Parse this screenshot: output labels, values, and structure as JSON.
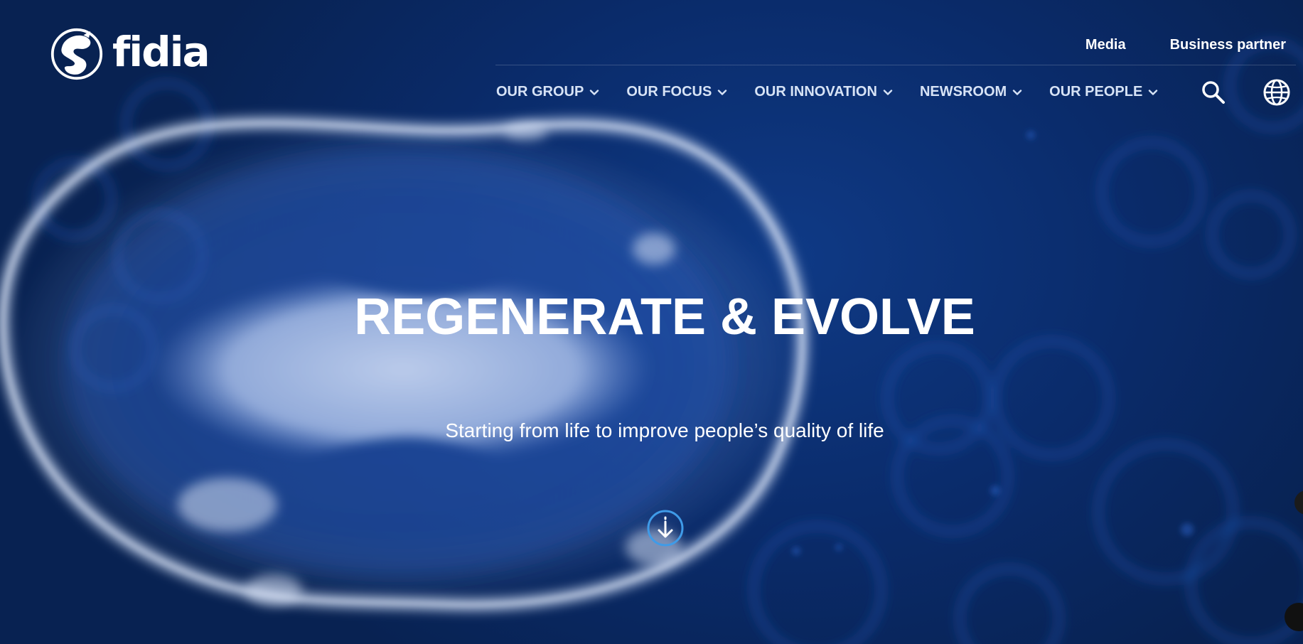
{
  "brand": {
    "name": "fidia",
    "logo_icon": "fidia-globe-logo-icon"
  },
  "top_links": [
    {
      "label": "Media"
    },
    {
      "label": "Business partner"
    }
  ],
  "main_nav": [
    {
      "label": "OUR GROUP",
      "icon": "chevron-down-icon"
    },
    {
      "label": "OUR FOCUS",
      "icon": "chevron-down-icon"
    },
    {
      "label": "OUR INNOVATION",
      "icon": "chevron-down-icon"
    },
    {
      "label": "NEWSROOM",
      "icon": "chevron-down-icon"
    },
    {
      "label": "OUR PEOPLE",
      "icon": "chevron-down-icon"
    }
  ],
  "nav_icons": {
    "search": "search-icon",
    "language": "globe-icon"
  },
  "hero": {
    "title": "REGENERATE & EVOLVE",
    "subtitle": "Starting from life to improve people’s quality of life",
    "scroll_icon": "arrow-down-circle-icon"
  },
  "colors": {
    "background": "#0b2a63",
    "accent": "#3f9be8",
    "text": "#ffffff",
    "nav_text": "#d7e3f6"
  }
}
